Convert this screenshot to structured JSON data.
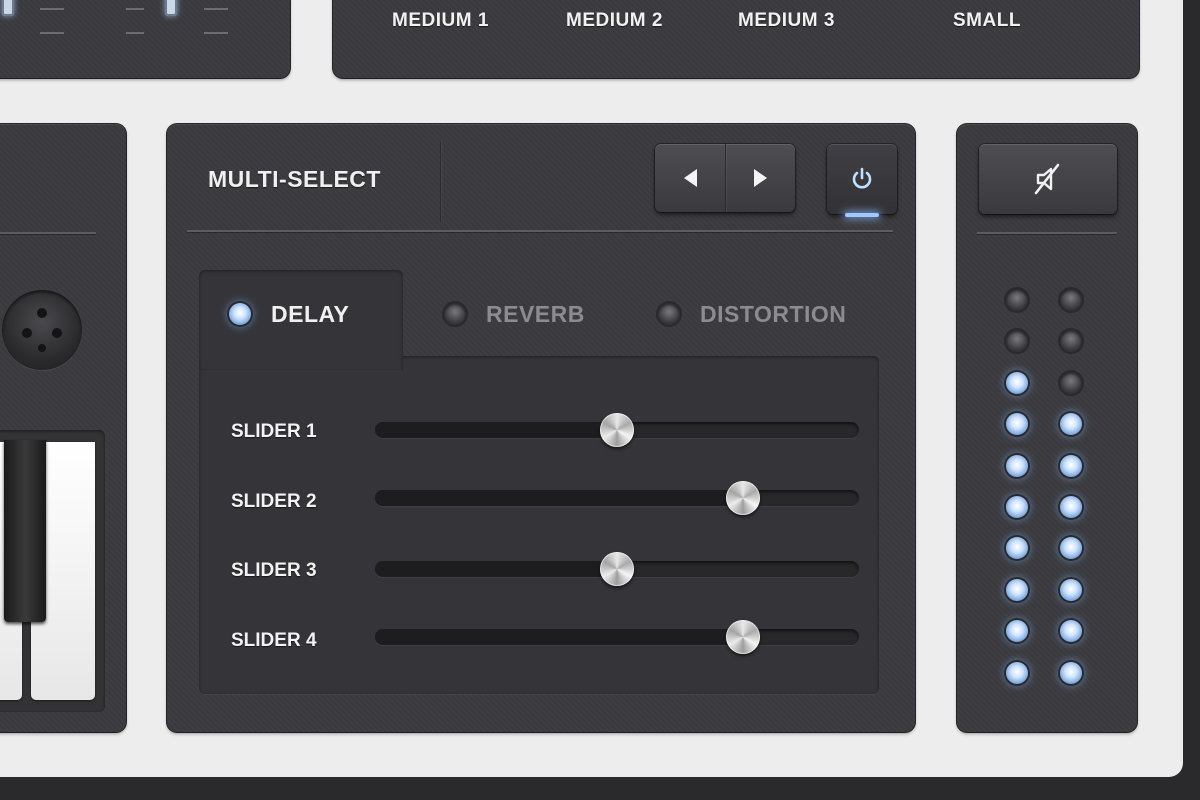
{
  "size_panel": {
    "options": [
      "MEDIUM 1",
      "MEDIUM 2",
      "MEDIUM 3",
      "SMALL"
    ]
  },
  "multi_select": {
    "title": "MULTI-SELECT",
    "tabs": [
      {
        "label": "DELAY",
        "active": true
      },
      {
        "label": "REVERB",
        "active": false
      },
      {
        "label": "DISTORTION",
        "active": false
      }
    ],
    "sliders": [
      {
        "label": "SLIDER 1",
        "value": 0.5
      },
      {
        "label": "SLIDER 2",
        "value": 0.76
      },
      {
        "label": "SLIDER 3",
        "value": 0.5
      },
      {
        "label": "SLIDER 4",
        "value": 0.76
      }
    ]
  },
  "vu_meter": {
    "left_channel_lit": 8,
    "right_channel_lit": 7,
    "total_leds": 10
  },
  "icons": {
    "power": "power-icon",
    "mute": "speaker-mute-icon",
    "prev": "arrow-left-icon",
    "next": "arrow-right-icon"
  },
  "colors": {
    "panel": "#3b3b3f",
    "frame": "#ededed",
    "led_on": "#cfe3ff",
    "active_text": "#f0f0f0",
    "inactive_text": "#8c8c90"
  }
}
